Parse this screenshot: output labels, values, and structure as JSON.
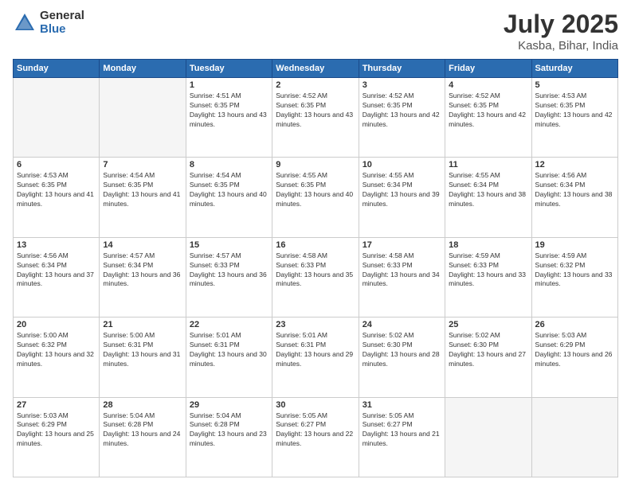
{
  "logo": {
    "general": "General",
    "blue": "Blue"
  },
  "title": {
    "month": "July 2025",
    "location": "Kasba, Bihar, India"
  },
  "weekdays": [
    "Sunday",
    "Monday",
    "Tuesday",
    "Wednesday",
    "Thursday",
    "Friday",
    "Saturday"
  ],
  "weeks": [
    [
      {
        "day": "",
        "empty": true
      },
      {
        "day": "",
        "empty": true
      },
      {
        "day": "1",
        "sunrise": "4:51 AM",
        "sunset": "6:35 PM",
        "daylight": "13 hours and 43 minutes."
      },
      {
        "day": "2",
        "sunrise": "4:52 AM",
        "sunset": "6:35 PM",
        "daylight": "13 hours and 43 minutes."
      },
      {
        "day": "3",
        "sunrise": "4:52 AM",
        "sunset": "6:35 PM",
        "daylight": "13 hours and 42 minutes."
      },
      {
        "day": "4",
        "sunrise": "4:52 AM",
        "sunset": "6:35 PM",
        "daylight": "13 hours and 42 minutes."
      },
      {
        "day": "5",
        "sunrise": "4:53 AM",
        "sunset": "6:35 PM",
        "daylight": "13 hours and 42 minutes."
      }
    ],
    [
      {
        "day": "6",
        "sunrise": "4:53 AM",
        "sunset": "6:35 PM",
        "daylight": "13 hours and 41 minutes."
      },
      {
        "day": "7",
        "sunrise": "4:54 AM",
        "sunset": "6:35 PM",
        "daylight": "13 hours and 41 minutes."
      },
      {
        "day": "8",
        "sunrise": "4:54 AM",
        "sunset": "6:35 PM",
        "daylight": "13 hours and 40 minutes."
      },
      {
        "day": "9",
        "sunrise": "4:55 AM",
        "sunset": "6:35 PM",
        "daylight": "13 hours and 40 minutes."
      },
      {
        "day": "10",
        "sunrise": "4:55 AM",
        "sunset": "6:34 PM",
        "daylight": "13 hours and 39 minutes."
      },
      {
        "day": "11",
        "sunrise": "4:55 AM",
        "sunset": "6:34 PM",
        "daylight": "13 hours and 38 minutes."
      },
      {
        "day": "12",
        "sunrise": "4:56 AM",
        "sunset": "6:34 PM",
        "daylight": "13 hours and 38 minutes."
      }
    ],
    [
      {
        "day": "13",
        "sunrise": "4:56 AM",
        "sunset": "6:34 PM",
        "daylight": "13 hours and 37 minutes."
      },
      {
        "day": "14",
        "sunrise": "4:57 AM",
        "sunset": "6:34 PM",
        "daylight": "13 hours and 36 minutes."
      },
      {
        "day": "15",
        "sunrise": "4:57 AM",
        "sunset": "6:33 PM",
        "daylight": "13 hours and 36 minutes."
      },
      {
        "day": "16",
        "sunrise": "4:58 AM",
        "sunset": "6:33 PM",
        "daylight": "13 hours and 35 minutes."
      },
      {
        "day": "17",
        "sunrise": "4:58 AM",
        "sunset": "6:33 PM",
        "daylight": "13 hours and 34 minutes."
      },
      {
        "day": "18",
        "sunrise": "4:59 AM",
        "sunset": "6:33 PM",
        "daylight": "13 hours and 33 minutes."
      },
      {
        "day": "19",
        "sunrise": "4:59 AM",
        "sunset": "6:32 PM",
        "daylight": "13 hours and 33 minutes."
      }
    ],
    [
      {
        "day": "20",
        "sunrise": "5:00 AM",
        "sunset": "6:32 PM",
        "daylight": "13 hours and 32 minutes."
      },
      {
        "day": "21",
        "sunrise": "5:00 AM",
        "sunset": "6:31 PM",
        "daylight": "13 hours and 31 minutes."
      },
      {
        "day": "22",
        "sunrise": "5:01 AM",
        "sunset": "6:31 PM",
        "daylight": "13 hours and 30 minutes."
      },
      {
        "day": "23",
        "sunrise": "5:01 AM",
        "sunset": "6:31 PM",
        "daylight": "13 hours and 29 minutes."
      },
      {
        "day": "24",
        "sunrise": "5:02 AM",
        "sunset": "6:30 PM",
        "daylight": "13 hours and 28 minutes."
      },
      {
        "day": "25",
        "sunrise": "5:02 AM",
        "sunset": "6:30 PM",
        "daylight": "13 hours and 27 minutes."
      },
      {
        "day": "26",
        "sunrise": "5:03 AM",
        "sunset": "6:29 PM",
        "daylight": "13 hours and 26 minutes."
      }
    ],
    [
      {
        "day": "27",
        "sunrise": "5:03 AM",
        "sunset": "6:29 PM",
        "daylight": "13 hours and 25 minutes."
      },
      {
        "day": "28",
        "sunrise": "5:04 AM",
        "sunset": "6:28 PM",
        "daylight": "13 hours and 24 minutes."
      },
      {
        "day": "29",
        "sunrise": "5:04 AM",
        "sunset": "6:28 PM",
        "daylight": "13 hours and 23 minutes."
      },
      {
        "day": "30",
        "sunrise": "5:05 AM",
        "sunset": "6:27 PM",
        "daylight": "13 hours and 22 minutes."
      },
      {
        "day": "31",
        "sunrise": "5:05 AM",
        "sunset": "6:27 PM",
        "daylight": "13 hours and 21 minutes."
      },
      {
        "day": "",
        "empty": true
      },
      {
        "day": "",
        "empty": true
      }
    ]
  ]
}
